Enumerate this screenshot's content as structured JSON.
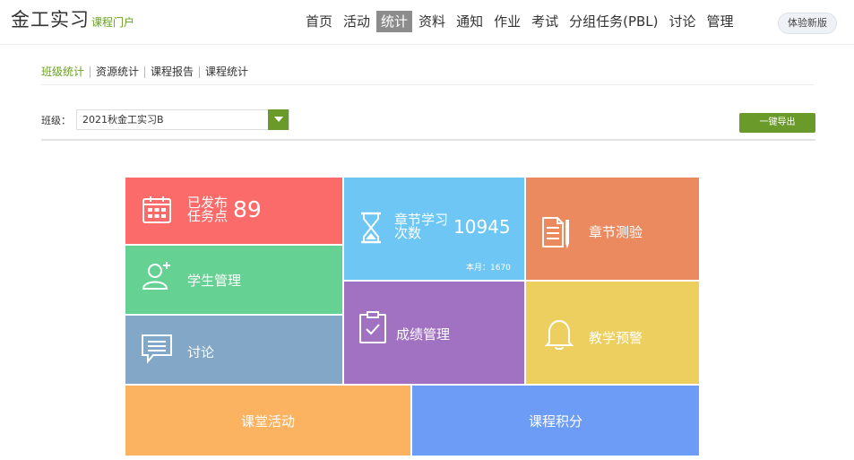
{
  "header": {
    "brand_title": "金工实习",
    "brand_sub": "课程门户",
    "nav": [
      {
        "label": "首页",
        "active": false
      },
      {
        "label": "活动",
        "active": false
      },
      {
        "label": "统计",
        "active": true
      },
      {
        "label": "资料",
        "active": false
      },
      {
        "label": "通知",
        "active": false
      },
      {
        "label": "作业",
        "active": false
      },
      {
        "label": "考试",
        "active": false
      },
      {
        "label": "分组任务(PBL)",
        "active": false
      },
      {
        "label": "讨论",
        "active": false
      },
      {
        "label": "管理",
        "active": false
      }
    ],
    "trial_label": "体验新版"
  },
  "subtabs": [
    {
      "label": "班级统计",
      "active": true
    },
    {
      "label": "资源统计",
      "active": false
    },
    {
      "label": "课程报告",
      "active": false
    },
    {
      "label": "课程统计",
      "active": false
    }
  ],
  "class_select": {
    "label": "班级：",
    "value": "2021秋金工实习B"
  },
  "export_label": "一键导出",
  "tiles": {
    "task": {
      "line1": "已发布",
      "line2": "任务点",
      "value": "89"
    },
    "chapter": {
      "line1": "章节学习",
      "line2": "次数",
      "value": "10945",
      "month": "本月：1670"
    },
    "quiz": {
      "label": "章节测验"
    },
    "student": {
      "label": "学生管理"
    },
    "discuss": {
      "label": "讨论"
    },
    "grade": {
      "label": "成绩管理"
    },
    "warning": {
      "label": "教学预警"
    },
    "activity": {
      "label": "课堂活动"
    },
    "credit": {
      "label": "课程积分"
    }
  },
  "colors": {
    "accent": "#6a9b2a",
    "task": "#fb6b69",
    "chapter": "#6ec6f5",
    "quiz": "#ec8a5f",
    "student": "#65d193",
    "discuss": "#82a7c7",
    "grade": "#a272c2",
    "warning": "#eccf5f",
    "activity": "#fbb261",
    "credit": "#6c9cf5"
  },
  "icons": {
    "task": "calendar-icon",
    "chapter": "hourglass-icon",
    "quiz": "document-pen-icon",
    "student": "add-user-icon",
    "discuss": "chat-icon",
    "grade": "clipboard-check-icon",
    "warning": "bell-icon"
  }
}
